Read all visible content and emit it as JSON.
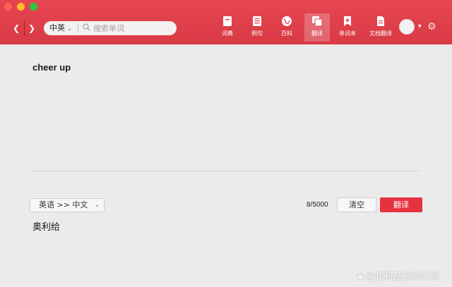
{
  "toolbar": {
    "lang_dropdown": "中英",
    "search_placeholder": "搜索单词",
    "tools": [
      {
        "label": "词典",
        "icon": "dictionary-icon"
      },
      {
        "label": "例句",
        "icon": "example-sentences-icon"
      },
      {
        "label": "百科",
        "icon": "encyclopedia-icon"
      },
      {
        "label": "翻译",
        "icon": "translate-icon",
        "active": true
      },
      {
        "label": "单词本",
        "icon": "wordbook-icon"
      },
      {
        "label": "文档翻译",
        "icon": "document-translate-icon"
      }
    ]
  },
  "main": {
    "source_text": "cheer up",
    "lang_pair": "英语 >> 中文",
    "char_count": "8/5000",
    "clear_label": "清空",
    "translate_label": "翻译",
    "result_text": "奥利给"
  },
  "watermark": "@我和基友的日常",
  "colors": {
    "brand_red": "#e54650",
    "button_red": "#e6323f",
    "background": "#ebebeb"
  }
}
